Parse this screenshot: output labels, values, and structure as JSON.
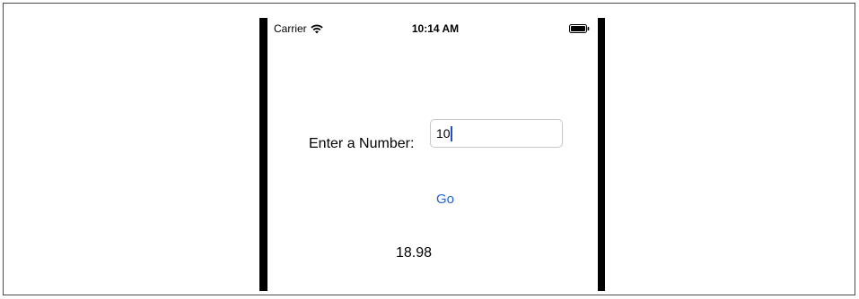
{
  "status_bar": {
    "carrier": "Carrier",
    "time": "10:14 AM",
    "wifi_icon": "wifi-icon",
    "battery_icon": "battery-icon"
  },
  "form": {
    "label": "Enter a Number:",
    "input_value": "10",
    "go_label": "Go",
    "result": "18.98"
  },
  "colors": {
    "accent": "#1f63d4",
    "cursor": "#1a4fd6"
  }
}
